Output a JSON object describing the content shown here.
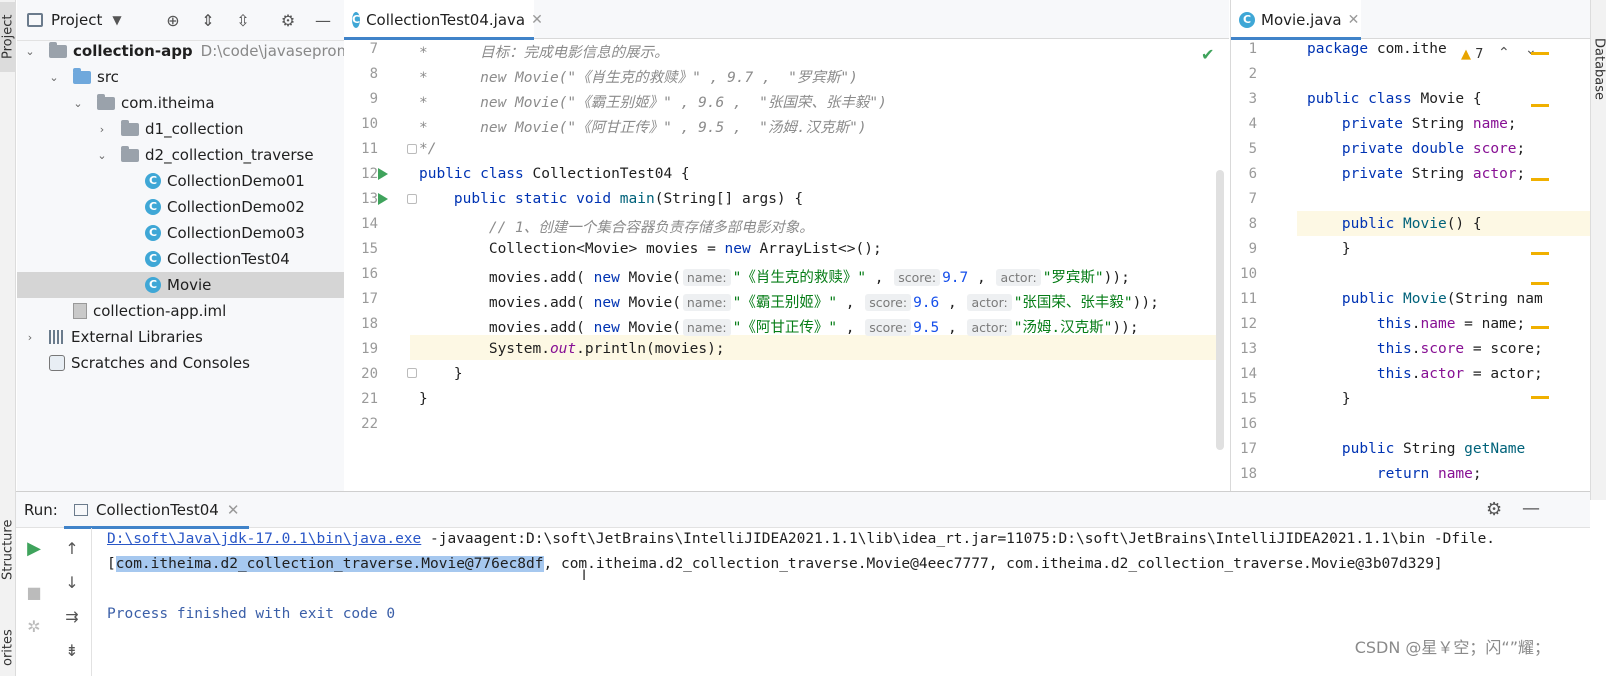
{
  "side_tabs": {
    "project": "Project",
    "structure": "Structure",
    "favorites": "orites",
    "database": "Database"
  },
  "project": {
    "title": "Project",
    "tree": [
      {
        "label": "collection-app",
        "path": "D:\\code\\javasepromax\\c"
      },
      {
        "label": "src"
      },
      {
        "label": "com.itheima"
      },
      {
        "label": "d1_collection"
      },
      {
        "label": "d2_collection_traverse"
      },
      {
        "label": "CollectionDemo01"
      },
      {
        "label": "CollectionDemo02"
      },
      {
        "label": "CollectionDemo03"
      },
      {
        "label": "CollectionTest04"
      },
      {
        "label": "Movie"
      },
      {
        "label": "collection-app.iml"
      },
      {
        "label": "External Libraries"
      },
      {
        "label": "Scratches and Consoles"
      }
    ]
  },
  "editor": {
    "tab": "CollectionTest04.java",
    "line_numbers": [
      "7",
      "8",
      "9",
      "10",
      "11",
      "12",
      "13",
      "14",
      "15",
      "16",
      "17",
      "18",
      "19",
      "20",
      "21",
      "22"
    ],
    "lines": {
      "l7a": "*",
      "l7b": "目标：完成电影信息的展示。",
      "l8a": "*",
      "l8b": "new Movie(\"《肖生克的救赎》\" , 9.7 ,  \"罗宾斯\")",
      "l9a": "*",
      "l9b": "new Movie(\"《霸王别姬》\" , 9.6 ,  \"张国荣、张丰毅\")",
      "l10a": "*",
      "l10b": "new Movie(\"《阿甘正传》\" , 9.5 ,  \"汤姆.汉克斯\")",
      "l11": "*/",
      "l12_kw": "public class",
      "l12_rest": " CollectionTest04 {",
      "l13_kw": "public static void",
      "l13_fn": "main",
      "l13_rest": "(String[] args) {",
      "l14": "// 1、创建一个集合容器负责存储多部电影对象。",
      "l15_a": "Collection<Movie> movies = ",
      "l15_kw": "new",
      "l15_b": " ArrayList<>();",
      "l16": {
        "pre": "movies.add( ",
        "kw": "new",
        "cls": " Movie(",
        "h1": "name:",
        "s1": "\"《肖生克的救赎》\"",
        "h2": "score:",
        "n": "9.7",
        "h3": "actor:",
        "s3": "\"罗宾斯\"",
        "end": "));"
      },
      "l17": {
        "pre": "movies.add( ",
        "kw": "new",
        "cls": " Movie(",
        "h1": "name:",
        "s1": "\"《霸王别姬》\"",
        "h2": "score:",
        "n": "9.6",
        "h3": "actor:",
        "s3": "\"张国荣、张丰毅\"",
        "end": "));"
      },
      "l18": {
        "pre": "movies.add( ",
        "kw": "new",
        "cls": " Movie(",
        "h1": "name:",
        "s1": "\"《阿甘正传》\"",
        "h2": "score:",
        "n": "9.5",
        "h3": "actor:",
        "s3": "\"汤姆.汉克斯\"",
        "end": "));"
      },
      "l19_a": "System.",
      "l19_out": "out",
      "l19_b": ".println(movies);",
      "l20": "}",
      "l21": "}"
    }
  },
  "editor2": {
    "tab": "Movie.java",
    "warnings": "7",
    "line_numbers": [
      "1",
      "2",
      "3",
      "4",
      "5",
      "6",
      "7",
      "8",
      "9",
      "10",
      "11",
      "12",
      "13",
      "14",
      "15",
      "16",
      "17",
      "18"
    ],
    "lines": {
      "l1_kw": "package",
      "l1_rest": " com.ithe",
      "l3_kw": "public class",
      "l3_rest": " Movie {",
      "l4_kw": "private",
      "l4_type": " String ",
      "l4_f": "name",
      "l4_end": ";",
      "l5_kw": "private double",
      "l5_f": " score",
      "l5_end": ";",
      "l6_kw": "private",
      "l6_type": " String ",
      "l6_f": "actor",
      "l6_end": ";",
      "l8_kw": "public",
      "l8_fn": " Movie",
      "l8_rest": "() {",
      "l9": "}",
      "l11_kw": "public",
      "l11_fn": " Movie",
      "l11_rest": "(String nam",
      "l12_kw": "this",
      "l12_dot": ".",
      "l12_f": "name",
      "l12_rest": " = name;",
      "l13_kw": "this",
      "l13_dot": ".",
      "l13_f": "score",
      "l13_rest": " = score;",
      "l14_kw": "this",
      "l14_dot": ".",
      "l14_f": "actor",
      "l14_rest": " = actor;",
      "l15": "}",
      "l17_kw": "public",
      "l17_type": " String ",
      "l17_fn": "getName",
      "l18_kw": "return",
      "l18_f": " name",
      "l18_end": ";"
    }
  },
  "run": {
    "label": "Run:",
    "tab": "CollectionTest04",
    "cmd_link": "D:\\soft\\Java\\jdk-17.0.1\\bin\\java.exe",
    "cmd_rest": " -javaagent:D:\\soft\\JetBrains\\IntelliJIDEA2021.1.1\\lib\\idea_rt.jar=11075:D:\\soft\\JetBrains\\IntelliJIDEA2021.1.1\\bin -Dfile.",
    "out_open": "[",
    "out_sel": "com.itheima.d2_collection_traverse.Movie@776ec8df",
    "out_rest": ", com.itheima.d2_collection_traverse.Movie@4eec7777, com.itheima.d2_collection_traverse.Movie@3b07d329]",
    "finished": "Process finished with exit code 0"
  },
  "watermark": "CSDN @星￥空；闪“”耀；",
  "colors": {
    "accent": "#4083c9",
    "keyword": "#0033b3",
    "string": "#067d17",
    "number": "#1750eb",
    "run_green": "#3fa35c"
  }
}
